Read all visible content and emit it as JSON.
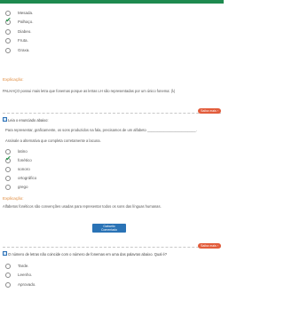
{
  "q1": {
    "options": [
      {
        "label": "Mesada.",
        "checked": false
      },
      {
        "label": "Palhaço.",
        "checked": true
      },
      {
        "label": "Diabeo.",
        "checked": false
      },
      {
        "label": "Fruta.",
        "checked": false
      },
      {
        "label": "Graxa.",
        "checked": false
      }
    ]
  },
  "explanation1": {
    "header": "Explicação:",
    "text": "PALHAÇO possui mais letra que fonemas porque as letras LH são representadas por um único fonema: |λ|"
  },
  "saiba_mais": "Saiba mais",
  "q2": {
    "prompt": "Leia o enunciado abaixo:",
    "statement": "Para representar, graficamente, os sons produzidos na fala, precisamos de um alfabeto ________________________.",
    "instruction": "Assinale a alternativa que completa corretamente a lacuna.",
    "options": [
      {
        "label": "latino",
        "checked": false
      },
      {
        "label": "fonético",
        "checked": true
      },
      {
        "label": "sonoro",
        "checked": false
      },
      {
        "label": "ortográfico",
        "checked": false
      },
      {
        "label": "grego",
        "checked": false
      }
    ]
  },
  "explanation2": {
    "header": "Explicação:",
    "text": "Alfabetos fonéticos são convenções usadas para representar todos os sons das línguas humanas."
  },
  "gabarito_button": {
    "line1": "Gabarito",
    "line2": "Comentado"
  },
  "q3": {
    "prompt": "O número de letras não coincide com o número de fonemas em uma das palavras abaixo. Qual é?",
    "options": [
      {
        "label": "Tarde.",
        "checked": false
      },
      {
        "label": "Leenho.",
        "checked": false
      },
      {
        "label": "Aprovado.",
        "checked": false
      }
    ]
  }
}
